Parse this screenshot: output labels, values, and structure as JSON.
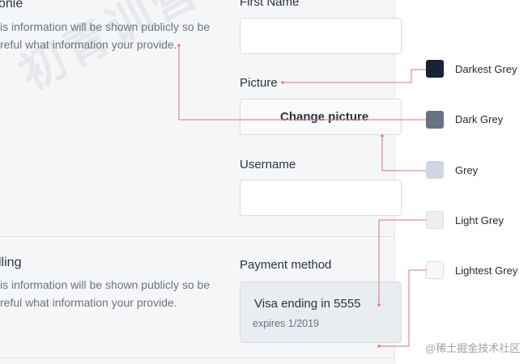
{
  "profile": {
    "title": "onie",
    "description_line1": "is information will be shown publicly so be",
    "description_line2": "reful what information your provide."
  },
  "fields": {
    "first_name_label": "First Name",
    "picture_label": "Picture",
    "change_picture": "Change picture",
    "username_label": "Username"
  },
  "billing": {
    "title": "lling",
    "description_line1": "is information will be shown publicly so be",
    "description_line2": "reful what information your provide.",
    "payment_label": "Payment method",
    "card_title": "Visa ending in 5555",
    "card_expiry": "expires 1/2019"
  },
  "palette": [
    {
      "name": "Darkest Grey",
      "color": "#1a2236"
    },
    {
      "name": "Dark Grey",
      "color": "#667386"
    },
    {
      "name": "Grey",
      "color": "#d0d7e3"
    },
    {
      "name": "Light Grey",
      "color": "#eceff2"
    },
    {
      "name": "Lightest Grey",
      "color": "#f7f8fa"
    }
  ],
  "connector_color": "#e0707a",
  "watermark": "@稀土掘金技术社区",
  "background_watermark": "初青训营"
}
